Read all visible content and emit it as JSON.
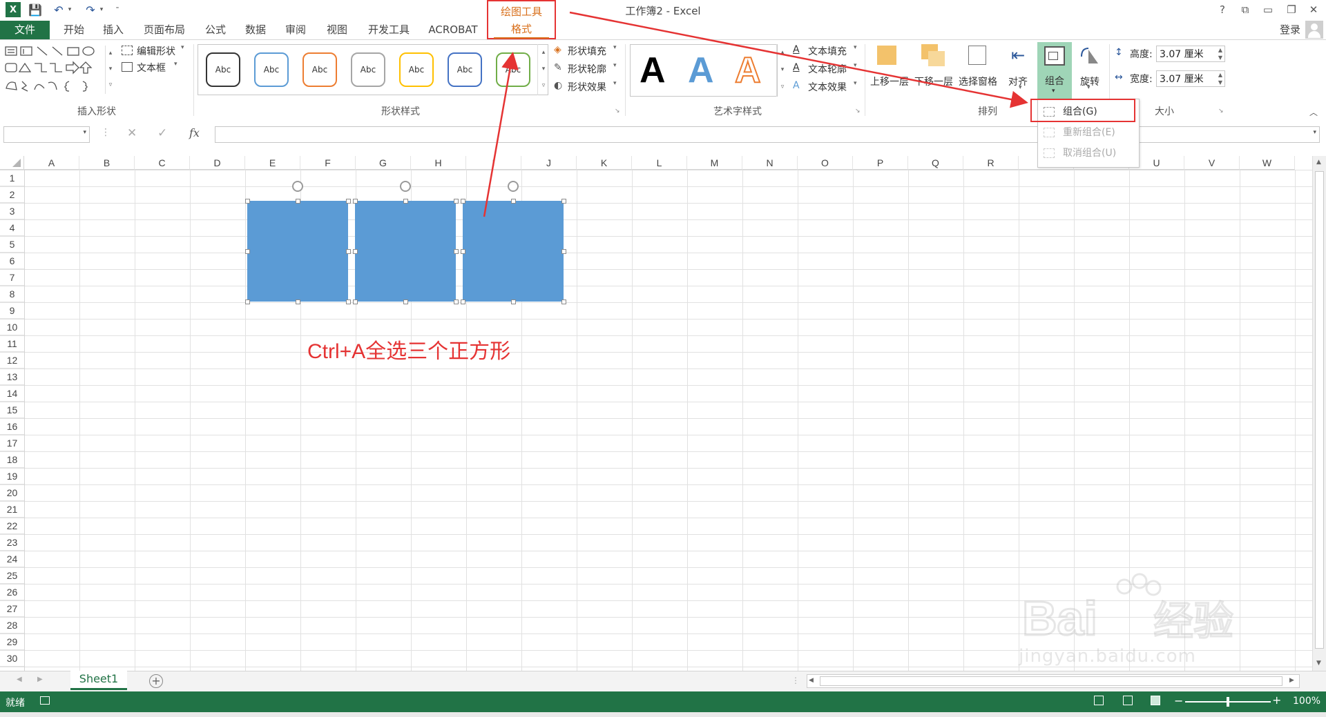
{
  "app": {
    "title": "工作簿2 - Excel",
    "help": "?",
    "signin": "登录"
  },
  "contextual_tab": {
    "group_label": "绘图工具",
    "tab_label": "格式"
  },
  "tabs": [
    "文件",
    "开始",
    "插入",
    "页面布局",
    "公式",
    "数据",
    "审阅",
    "视图",
    "开发工具",
    "ACROBAT"
  ],
  "ribbon": {
    "insert_shapes": {
      "label": "插入形状",
      "edit_shape": "编辑形状",
      "textbox": "文本框"
    },
    "shape_styles": {
      "label": "形状样式",
      "gallery": [
        "Abc",
        "Abc",
        "Abc",
        "Abc",
        "Abc",
        "Abc",
        "Abc"
      ],
      "fill": "形状填充",
      "outline": "形状轮廓",
      "effects": "形状效果"
    },
    "wordart": {
      "label": "艺术字样式",
      "samples": [
        "A",
        "A",
        "A"
      ],
      "text_fill": "文本填充",
      "text_outline": "文本轮廓",
      "text_effects": "文本效果"
    },
    "arrange": {
      "label": "排列",
      "bring_forward": "上移一层",
      "send_backward": "下移一层",
      "selection_pane": "选择窗格",
      "align": "对齐",
      "group": "组合",
      "rotate": "旋转"
    },
    "size": {
      "label": "大小",
      "height_label": "高度:",
      "height_value": "3.07 厘米",
      "width_label": "宽度:",
      "width_value": "3.07 厘米"
    }
  },
  "group_menu": {
    "items": [
      {
        "label": "组合(G)",
        "enabled": true
      },
      {
        "label": "重新组合(E)",
        "enabled": false
      },
      {
        "label": "取消组合(U)",
        "enabled": false
      }
    ]
  },
  "formula_bar": {
    "fx": "fx",
    "cancel": "✕",
    "enter": "✓"
  },
  "grid": {
    "columns": [
      "A",
      "B",
      "C",
      "D",
      "E",
      "F",
      "G",
      "H",
      "I",
      "J",
      "K",
      "L",
      "M",
      "N",
      "O",
      "P",
      "Q",
      "R",
      "S",
      "T",
      "U",
      "V",
      "W"
    ],
    "rows": [
      "1",
      "2",
      "3",
      "4",
      "5",
      "6",
      "7",
      "8",
      "9",
      "10",
      "11",
      "12",
      "13",
      "14",
      "15",
      "16",
      "17",
      "18",
      "19",
      "20",
      "21",
      "22",
      "23",
      "24",
      "25",
      "26",
      "27",
      "28",
      "29",
      "30"
    ]
  },
  "annotation": {
    "text": "Ctrl+A全选三个正方形",
    "color": "#e53333"
  },
  "sheet_tabs": [
    "Sheet1"
  ],
  "status": {
    "ready": "就绪",
    "zoom": "100%"
  },
  "watermark": {
    "logo_text": "Baidu经验",
    "url": "jingyan.baidu.com"
  },
  "colors": {
    "excel_green": "#217346",
    "shape_fill": "#5b9bd5",
    "contextual_orange": "#d86f1b",
    "annotation_red": "#e53333"
  }
}
